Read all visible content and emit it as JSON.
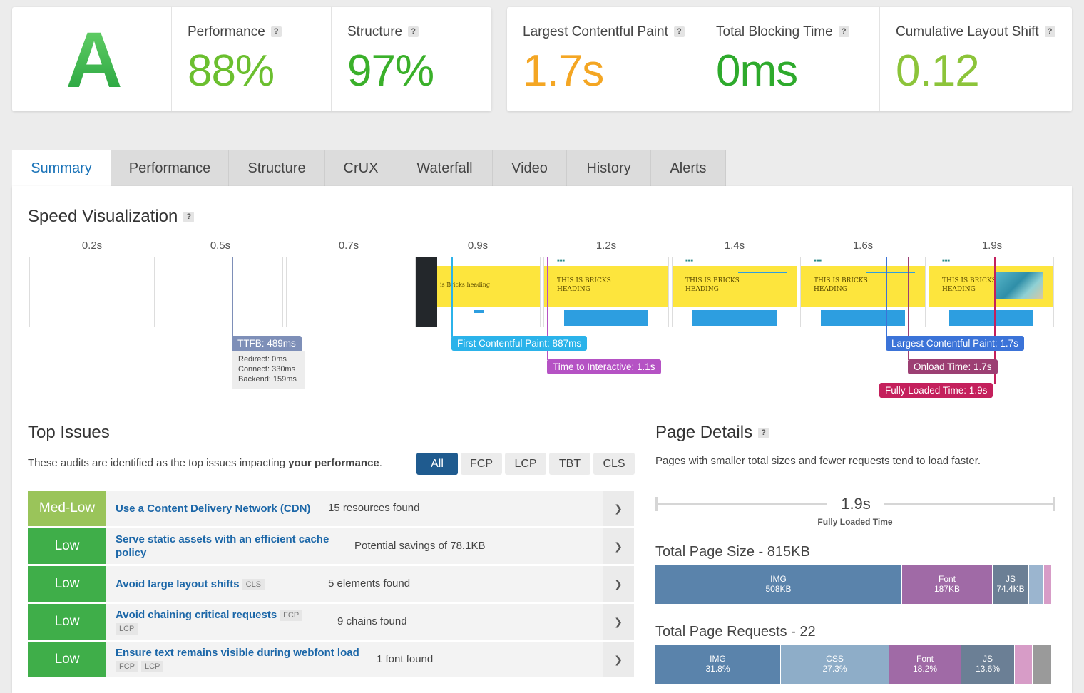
{
  "grade": "A",
  "scores": [
    {
      "label": "Performance",
      "value": "88%",
      "color": "#6bbf2f"
    },
    {
      "label": "Structure",
      "value": "97%",
      "color": "#3ab02a"
    }
  ],
  "vitals": [
    {
      "label": "Largest Contentful Paint",
      "value": "1.7s",
      "color": "#f4a623"
    },
    {
      "label": "Total Blocking Time",
      "value": "0ms",
      "color": "#2eaa2c"
    },
    {
      "label": "Cumulative Layout Shift",
      "value": "0.12",
      "color": "#8cc43a"
    }
  ],
  "help_icon": "?",
  "tabs": [
    "Summary",
    "Performance",
    "Structure",
    "CrUX",
    "Waterfall",
    "Video",
    "History",
    "Alerts"
  ],
  "speed": {
    "title": "Speed Visualization",
    "times": [
      "0.2s",
      "0.5s",
      "0.7s",
      "0.9s",
      "1.2s",
      "1.4s",
      "1.6s",
      "1.9s"
    ],
    "frame_partial_heading": "is Bricks heading",
    "frame_heading_line1": "THIS IS BRICKS",
    "frame_heading_line2": "HEADING",
    "markers": {
      "ttfb": "TTFB: 489ms",
      "redirect": "Redirect: 0ms",
      "connect": "Connect: 330ms",
      "backend": "Backend: 159ms",
      "fcp": "First Contentful Paint: 887ms",
      "tti": "Time to Interactive: 1.1s",
      "lcp": "Largest Contentful Paint: 1.7s",
      "onload": "Onload Time: 1.7s",
      "fully": "Fully Loaded Time: 1.9s"
    }
  },
  "top_issues": {
    "title": "Top Issues",
    "desc_prefix": "These audits are identified as the top issues impacting ",
    "desc_bold": "your performance",
    "desc_suffix": ".",
    "filters": [
      "All",
      "FCP",
      "LCP",
      "TBT",
      "CLS"
    ],
    "items": [
      {
        "severity": "Med-Low",
        "color": "#9ac45a",
        "title": "Use a Content Delivery Network (CDN)",
        "badges": [],
        "detail": "15 resources found"
      },
      {
        "severity": "Low",
        "color": "#3fae49",
        "title_line1": "Serve static assets with an efficient cache",
        "title_line2": "policy",
        "badges": [],
        "detail": "Potential savings of 78.1KB"
      },
      {
        "severity": "Low",
        "color": "#3fae49",
        "title": "Avoid large layout shifts",
        "badges": [
          "CLS"
        ],
        "detail": "5 elements found"
      },
      {
        "severity": "Low",
        "color": "#3fae49",
        "title": "Avoid chaining critical requests",
        "badges": [
          "FCP",
          "LCP"
        ],
        "detail": "9 chains found"
      },
      {
        "severity": "Low",
        "color": "#3fae49",
        "title": "Ensure text remains visible during webfont load",
        "badges": [
          "FCP",
          "LCP"
        ],
        "detail": "1 font found"
      }
    ]
  },
  "page_details": {
    "title": "Page Details",
    "desc": "Pages with smaller total sizes and fewer requests tend to load faster.",
    "fully_loaded_value": "1.9s",
    "fully_loaded_label": "Fully Loaded Time",
    "size_title": "Total Page Size - 815KB",
    "size_segments": [
      {
        "type": "IMG",
        "value": "508KB",
        "share": 0.623,
        "color": "#5a83ab"
      },
      {
        "type": "Font",
        "value": "187KB",
        "share": 0.229,
        "color": "#a06aa6"
      },
      {
        "type": "JS",
        "value": "74.4KB",
        "share": 0.091,
        "color": "#6b7f95"
      },
      {
        "type": "",
        "value": "",
        "share": 0.038,
        "color": "#9bb5cf"
      },
      {
        "type": "",
        "value": "",
        "share": 0.019,
        "color": "#d79cc7"
      }
    ],
    "requests_title": "Total Page Requests - 22",
    "request_segments": [
      {
        "type": "IMG",
        "value": "31.8%",
        "share": 0.318,
        "color": "#5a83ab"
      },
      {
        "type": "CSS",
        "value": "27.3%",
        "share": 0.273,
        "color": "#8eadc8"
      },
      {
        "type": "Font",
        "value": "18.2%",
        "share": 0.182,
        "color": "#a06aa6"
      },
      {
        "type": "JS",
        "value": "13.6%",
        "share": 0.136,
        "color": "#6b7f95"
      },
      {
        "type": "",
        "value": "",
        "share": 0.045,
        "color": "#d79cc7"
      },
      {
        "type": "",
        "value": "",
        "share": 0.046,
        "color": "#9a9a9a"
      }
    ]
  }
}
